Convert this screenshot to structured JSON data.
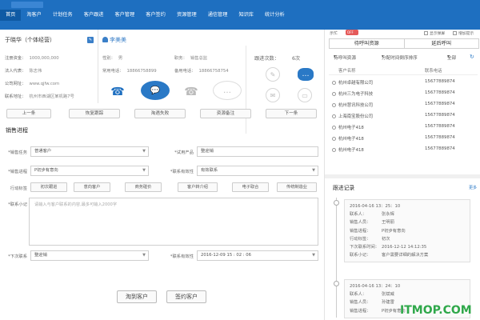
{
  "nav": {
    "items": [
      "首页",
      "淘客户",
      "计划任务",
      "客户跟进",
      "客户管理",
      "客户签约",
      "资源管理",
      "通信管理",
      "知识库",
      "统计分析"
    ]
  },
  "customer": {
    "name": "于晓华（个体经营）",
    "fields": [
      {
        "label": "注册资金：",
        "value": "1000,000,000"
      },
      {
        "label": "法人代表：",
        "value": "陈志伟"
      },
      {
        "label": "公司网址：",
        "value": "www.qjfw.com"
      },
      {
        "label": "联系地址：",
        "value": "杭州市西湖区某机路7号"
      }
    ]
  },
  "contact": {
    "name": "李美美",
    "gender_label": "性别：",
    "gender": "男",
    "position_label": "职务：",
    "position": "销售总监",
    "phone_label": "常用电话：",
    "phone": "18866758899",
    "alt_phone_label": "备用电话：",
    "alt_phone": "18866758754"
  },
  "follow": {
    "label": "跟进次数：",
    "count": "6次"
  },
  "action_buttons": [
    "上一条",
    "恢复跟踪",
    "淘遇失败",
    "资源备注",
    "下一条"
  ],
  "sales": {
    "title": "销售进程",
    "rows": [
      {
        "label1": "*销售任务",
        "value1": "普通客户",
        "label2": "*试用产品",
        "value2": "整迎销"
      },
      {
        "label1": "*销售进程",
        "value1": "P初步有意向",
        "label2": "*联系有效性",
        "value2": "有效联系"
      }
    ],
    "action_label": "行动标签",
    "tags": [
      "初次跟进",
      "意向客户",
      "商务碰价",
      "客户转介绍",
      "电子取合",
      "传统制造业"
    ],
    "note_label": "*联系小记",
    "note_placeholder": "请输入与客户联系的内容,最多可输入2000字",
    "next_label": "*下次联系",
    "next_value": "整迎销",
    "next_time_label": "*联系有效性",
    "next_time_value": "2016-12-09 15 : 02 : 06",
    "buttons": [
      "淘到客户",
      "签约客户"
    ]
  },
  "right": {
    "busy_label": "示忙",
    "busy_state": "OFF",
    "top_options": [
      "显示弹屏",
      "增加提示"
    ],
    "tabs": [
      "待呼叫资源",
      "延后呼叫"
    ],
    "filters": [
      "待呼叫资源",
      "分配时间倒序排序",
      "全部"
    ],
    "table_headers": [
      "客户名称",
      "联系电话"
    ],
    "rows": [
      {
        "name": "杭州卓越有限公司",
        "phone": "15677889874"
      },
      {
        "name": "杭州三为电子科技",
        "phone": "15677889874"
      },
      {
        "name": "杭州慧讯科技公司",
        "phone": "15677889874"
      },
      {
        "name": "上海南宝股份公司",
        "phone": "15677889874"
      },
      {
        "name": "杭州电子418",
        "phone": "15677889874"
      },
      {
        "name": "杭州电子418",
        "phone": "15677889874"
      },
      {
        "name": "杭州电子418",
        "phone": "15677889874"
      }
    ],
    "record_title": "跟进记录",
    "record_more": "更多",
    "records": [
      {
        "time": "2016-04-16 13：25：10",
        "lines": [
          {
            "k": "联系人：",
            "v": "张永辉"
          },
          {
            "k": "销售人员：",
            "v": "王明丽"
          },
          {
            "k": "销售进程：",
            "v": "P初步有意向"
          },
          {
            "k": "行动标签：",
            "v": "初次"
          },
          {
            "k": "下次联系时间：",
            "v": "2016-12-12 14:12:35"
          },
          {
            "k": "联系小记：",
            "v": "客户需要详细的解决方案"
          }
        ]
      },
      {
        "time": "2016-04-16 13：24：10",
        "lines": [
          {
            "k": "联系人：",
            "v": "张斌威"
          },
          {
            "k": "销售人员：",
            "v": "孙建雷"
          },
          {
            "k": "销售进程：",
            "v": "P初步有意向"
          }
        ]
      }
    ]
  },
  "watermark": "ITMOP.COM"
}
